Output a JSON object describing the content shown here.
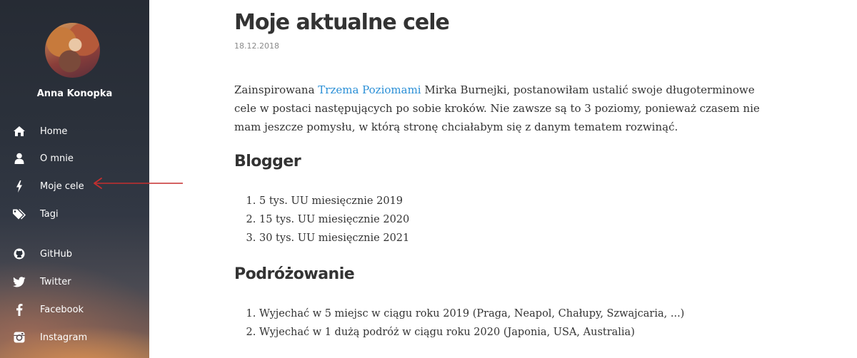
{
  "sidebar": {
    "author_name": "Anna Konopka",
    "nav": [
      {
        "label": "Home",
        "icon": "home-icon"
      },
      {
        "label": "O mnie",
        "icon": "user-icon"
      },
      {
        "label": "Moje cele",
        "icon": "bolt-icon"
      },
      {
        "label": "Tagi",
        "icon": "tags-icon"
      }
    ],
    "social": [
      {
        "label": "GitHub",
        "icon": "github-icon"
      },
      {
        "label": "Twitter",
        "icon": "twitter-icon"
      },
      {
        "label": "Facebook",
        "icon": "facebook-icon"
      },
      {
        "label": "Instagram",
        "icon": "instagram-icon"
      }
    ]
  },
  "annotation": {
    "arrow_color": "#c62f2f"
  },
  "post": {
    "title": "Moje aktualne cele",
    "date": "18.12.2018",
    "intro_before_link": "Zainspirowana ",
    "intro_link": "Trzema Poziomami",
    "intro_after_link": " Mirka Burnejki, postanowiłam ustalić swoje długoterminowe cele w postaci następujących po sobie kroków. Nie zawsze są to 3 poziomy, ponieważ czasem nie mam jeszcze pomysłu, w którą stronę chciałabym się z danym tematem rozwinąć.",
    "link_color": "#2a8fd6",
    "sections": [
      {
        "heading": "Blogger",
        "items": [
          "5 tys. UU miesięcznie 2019",
          "15 tys. UU miesięcznie 2020",
          "30 tys. UU miesięcznie 2021"
        ]
      },
      {
        "heading": "Podróżowanie",
        "items": [
          "Wyjechać w 5 miejsc w ciągu roku 2019 (Praga, Neapol, Chałupy, Szwajcaria, ...)",
          "Wyjechać w 1 dużą podróż w ciągu roku 2020 (Japonia, USA, Australia)"
        ]
      }
    ]
  }
}
